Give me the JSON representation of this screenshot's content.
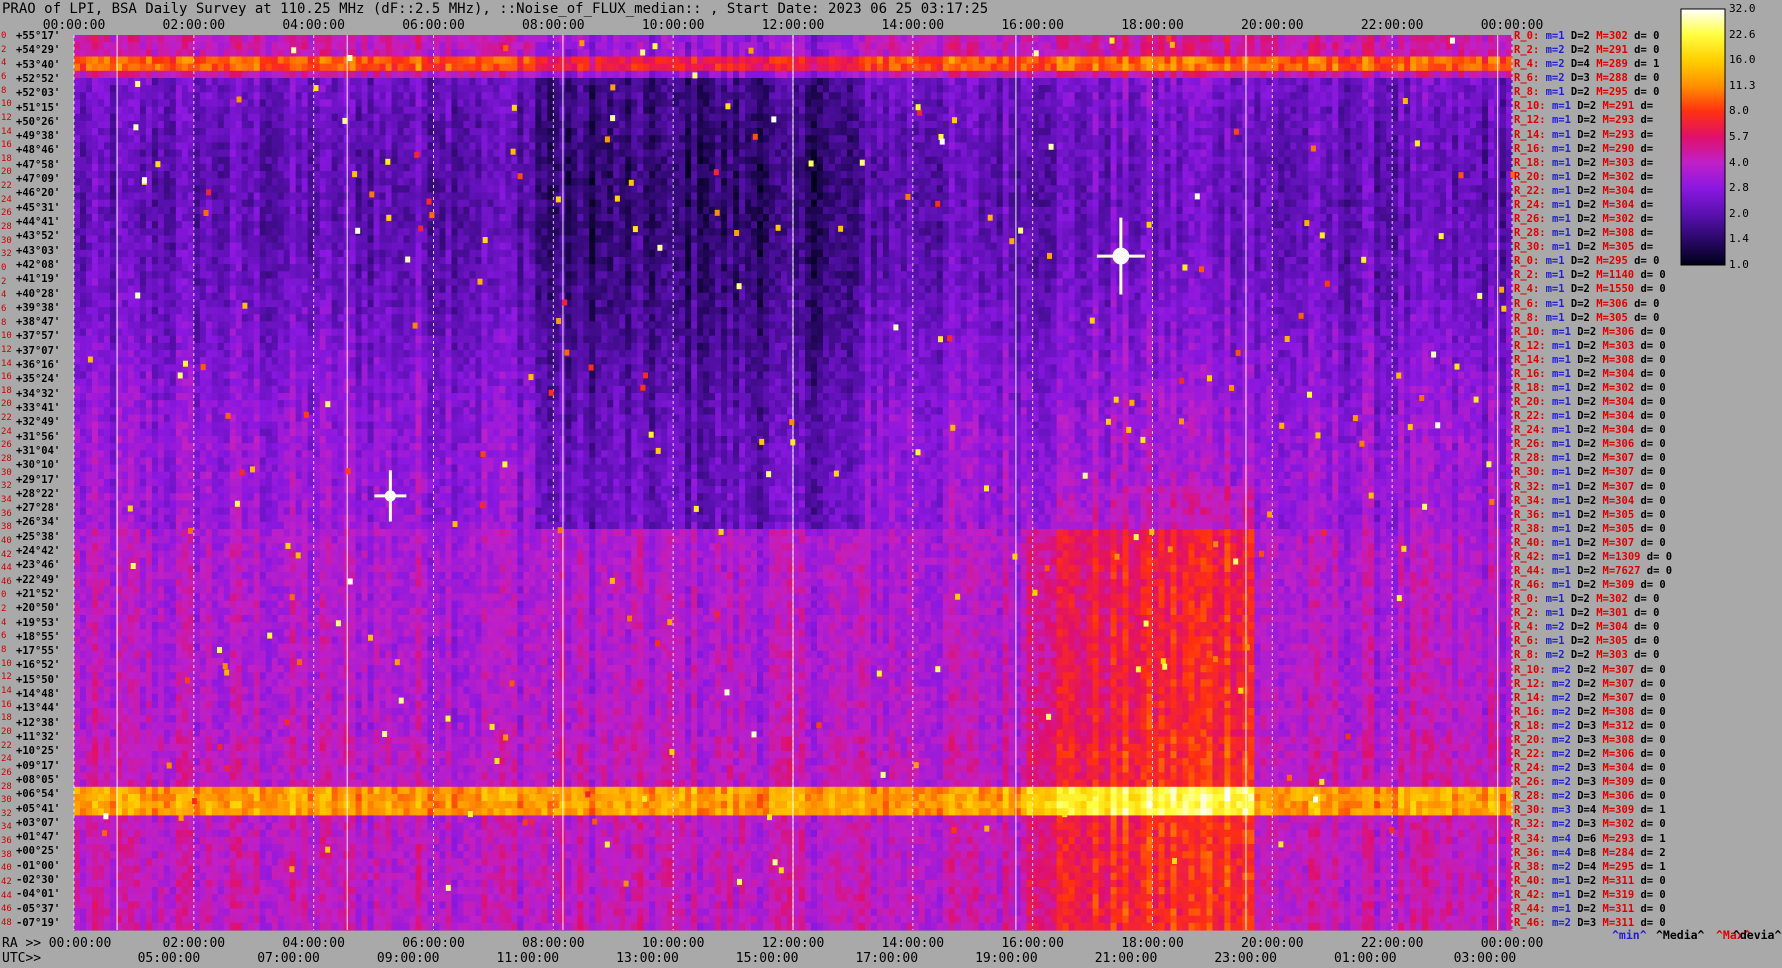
{
  "title": "PRAO of LPI, BSA Daily Survey at 110.25 MHz (dF::2.5 MHz), ::Noise_of_FLUX_median:: , Start Date: 2023 06 25 03:17:25",
  "chart_data": {
    "type": "heatmap",
    "title": "PRAO of LPI, BSA Daily Survey at 110.25 MHz (dF::2.5 MHz), ::Noise_of_FLUX_median:: , Start Date: 2023 06 25 03:17:25",
    "x_top_ticks": [
      "00:00:00",
      "02:00:00",
      "04:00:00",
      "06:00:00",
      "08:00:00",
      "10:00:00",
      "12:00:00",
      "14:00:00",
      "16:00:00",
      "18:00:00",
      "20:00:00",
      "22:00:00",
      "00:00:00"
    ],
    "x_ra_label": "RA >>",
    "x_ra_ticks": [
      "00:00:00",
      "02:00:00",
      "04:00:00",
      "06:00:00",
      "08:00:00",
      "10:00:00",
      "12:00:00",
      "14:00:00",
      "16:00:00",
      "18:00:00",
      "20:00:00",
      "22:00:00",
      "00:00:00"
    ],
    "x_utc_label": "UTC>>",
    "x_utc_ticks": [
      "05:00:00",
      "07:00:00",
      "09:00:00",
      "11:00:00",
      "13:00:00",
      "15:00:00",
      "17:00:00",
      "19:00:00",
      "21:00:00",
      "23:00:00",
      "01:00:00",
      "03:00:00"
    ],
    "y_ticks": [
      "+55°17'",
      "+54°29'",
      "+53°40'",
      "+52°52'",
      "+52°03'",
      "+51°15'",
      "+50°26'",
      "+49°38'",
      "+48°46'",
      "+47°58'",
      "+47°09'",
      "+46°20'",
      "+45°31'",
      "+44°41'",
      "+43°52'",
      "+43°03'",
      "+42°08'",
      "+41°19'",
      "+40°28'",
      "+39°38'",
      "+38°47'",
      "+37°57'",
      "+37°07'",
      "+36°16'",
      "+35°24'",
      "+34°32'",
      "+33°41'",
      "+32°49'",
      "+31°56'",
      "+31°04'",
      "+30°10'",
      "+29°17'",
      "+28°22'",
      "+27°28'",
      "+26°34'",
      "+25°38'",
      "+24°42'",
      "+23°46'",
      "+22°49'",
      "+21°52'",
      "+20°50'",
      "+19°53'",
      "+18°55'",
      "+17°55'",
      "+16°52'",
      "+15°50'",
      "+14°48'",
      "+13°44'",
      "+12°38'",
      "+11°32'",
      "+10°25'",
      "+09°17'",
      "+08°05'",
      "+06°54'",
      "+05°41'",
      "+03°07'",
      "+01°47'",
      "+00°25'",
      "-01°00'",
      "-02°30'",
      "-04°01'",
      "-05°37'",
      "-07°19'"
    ],
    "row_numbers": [
      "0",
      "2",
      "4",
      "6",
      "8",
      "10",
      "12",
      "14",
      "16",
      "18",
      "20",
      "22",
      "24",
      "26",
      "28",
      "30",
      "32",
      "0",
      "2",
      "4",
      "6",
      "8",
      "10",
      "12",
      "14",
      "16",
      "18",
      "20",
      "22",
      "24",
      "26",
      "28",
      "30",
      "32",
      "34",
      "36",
      "38",
      "40",
      "42",
      "44",
      "46",
      "0",
      "2",
      "4",
      "6",
      "8",
      "10",
      "12",
      "14",
      "16",
      "18",
      "20",
      "22",
      "24",
      "26",
      "28",
      "30",
      "32",
      "34",
      "36",
      "38",
      "40",
      "42",
      "44",
      "46",
      "48"
    ],
    "colorbar": {
      "ticks": [
        "32.0",
        "22.6",
        "16.0",
        "11.3",
        "8.0",
        "5.7",
        "4.0",
        "2.8",
        "2.0",
        "1.4",
        "1.0"
      ],
      "colors": [
        "#ffffff",
        "#ffff40",
        "#ffd000",
        "#ff9000",
        "#ff3010",
        "#e0106a",
        "#c020c8",
        "#8a18e0",
        "#5a10b0",
        "#2a0868",
        "#000018"
      ]
    },
    "stats_header": [
      "^min^",
      "^Media^",
      "^Max^",
      "^devia^"
    ],
    "stats_rows": [
      {
        "r": "R_0:",
        "m": "m=1",
        "d": "D=2",
        "mx": "M=302",
        "dv": "d= 0"
      },
      {
        "r": "R_2:",
        "m": "m=2",
        "d": "D=2",
        "mx": "M=291",
        "dv": "d= 0"
      },
      {
        "r": "R_4:",
        "m": "m=2",
        "d": "D=4",
        "mx": "M=289",
        "dv": "d= 1"
      },
      {
        "r": "R_6:",
        "m": "m=2",
        "d": "D=3",
        "mx": "M=288",
        "dv": "d= 0"
      },
      {
        "r": "R_8:",
        "m": "m=1",
        "d": "D=2",
        "mx": "M=295",
        "dv": "d= 0"
      },
      {
        "r": "R_10:",
        "m": "m=1",
        "d": "D=2",
        "mx": "M=291",
        "dv": "d="
      },
      {
        "r": "R_12:",
        "m": "m=1",
        "d": "D=2",
        "mx": "M=293",
        "dv": "d="
      },
      {
        "r": "R_14:",
        "m": "m=1",
        "d": "D=2",
        "mx": "M=293",
        "dv": "d="
      },
      {
        "r": "R_16:",
        "m": "m=1",
        "d": "D=2",
        "mx": "M=290",
        "dv": "d="
      },
      {
        "r": "R_18:",
        "m": "m=1",
        "d": "D=2",
        "mx": "M=303",
        "dv": "d="
      },
      {
        "r": "R_20:",
        "m": "m=1",
        "d": "D=2",
        "mx": "M=302",
        "dv": "d="
      },
      {
        "r": "R_22:",
        "m": "m=1",
        "d": "D=2",
        "mx": "M=304",
        "dv": "d="
      },
      {
        "r": "R_24:",
        "m": "m=1",
        "d": "D=2",
        "mx": "M=304",
        "dv": "d="
      },
      {
        "r": "R_26:",
        "m": "m=1",
        "d": "D=2",
        "mx": "M=302",
        "dv": "d="
      },
      {
        "r": "R_28:",
        "m": "m=1",
        "d": "D=2",
        "mx": "M=308",
        "dv": "d="
      },
      {
        "r": "R_30:",
        "m": "m=1",
        "d": "D=2",
        "mx": "M=305",
        "dv": "d="
      },
      {
        "r": "R_0:",
        "m": "m=1",
        "d": "D=2",
        "mx": "M=295",
        "dv": "d= 0"
      },
      {
        "r": "R_2:",
        "m": "m=1",
        "d": "D=2",
        "mx": "M=1140",
        "dv": "d= 0"
      },
      {
        "r": "R_4:",
        "m": "m=1",
        "d": "D=2",
        "mx": "M=1550",
        "dv": "d= 0"
      },
      {
        "r": "R_6:",
        "m": "m=1",
        "d": "D=2",
        "mx": "M=306",
        "dv": "d= 0"
      },
      {
        "r": "R_8:",
        "m": "m=1",
        "d": "D=2",
        "mx": "M=305",
        "dv": "d= 0"
      },
      {
        "r": "R_10:",
        "m": "m=1",
        "d": "D=2",
        "mx": "M=306",
        "dv": "d= 0"
      },
      {
        "r": "R_12:",
        "m": "m=1",
        "d": "D=2",
        "mx": "M=303",
        "dv": "d= 0"
      },
      {
        "r": "R_14:",
        "m": "m=1",
        "d": "D=2",
        "mx": "M=308",
        "dv": "d= 0"
      },
      {
        "r": "R_16:",
        "m": "m=1",
        "d": "D=2",
        "mx": "M=304",
        "dv": "d= 0"
      },
      {
        "r": "R_18:",
        "m": "m=1",
        "d": "D=2",
        "mx": "M=302",
        "dv": "d= 0"
      },
      {
        "r": "R_20:",
        "m": "m=1",
        "d": "D=2",
        "mx": "M=304",
        "dv": "d= 0"
      },
      {
        "r": "R_22:",
        "m": "m=1",
        "d": "D=2",
        "mx": "M=304",
        "dv": "d= 0"
      },
      {
        "r": "R_24:",
        "m": "m=1",
        "d": "D=2",
        "mx": "M=304",
        "dv": "d= 0"
      },
      {
        "r": "R_26:",
        "m": "m=1",
        "d": "D=2",
        "mx": "M=306",
        "dv": "d= 0"
      },
      {
        "r": "R_28:",
        "m": "m=1",
        "d": "D=2",
        "mx": "M=307",
        "dv": "d= 0"
      },
      {
        "r": "R_30:",
        "m": "m=1",
        "d": "D=2",
        "mx": "M=307",
        "dv": "d= 0"
      },
      {
        "r": "R_32:",
        "m": "m=1",
        "d": "D=2",
        "mx": "M=307",
        "dv": "d= 0"
      },
      {
        "r": "R_34:",
        "m": "m=1",
        "d": "D=2",
        "mx": "M=304",
        "dv": "d= 0"
      },
      {
        "r": "R_36:",
        "m": "m=1",
        "d": "D=2",
        "mx": "M=305",
        "dv": "d= 0"
      },
      {
        "r": "R_38:",
        "m": "m=1",
        "d": "D=2",
        "mx": "M=305",
        "dv": "d= 0"
      },
      {
        "r": "R_40:",
        "m": "m=1",
        "d": "D=2",
        "mx": "M=307",
        "dv": "d= 0"
      },
      {
        "r": "R_42:",
        "m": "m=1",
        "d": "D=2",
        "mx": "M=1309",
        "dv": "d= 0"
      },
      {
        "r": "R_44:",
        "m": "m=1",
        "d": "D=2",
        "mx": "M=7627",
        "dv": "d= 0"
      },
      {
        "r": "R_46:",
        "m": "m=1",
        "d": "D=2",
        "mx": "M=309",
        "dv": "d= 0"
      },
      {
        "r": "R_0:",
        "m": "m=1",
        "d": "D=2",
        "mx": "M=302",
        "dv": "d= 0"
      },
      {
        "r": "R_2:",
        "m": "m=1",
        "d": "D=2",
        "mx": "M=301",
        "dv": "d= 0"
      },
      {
        "r": "R_4:",
        "m": "m=2",
        "d": "D=2",
        "mx": "M=304",
        "dv": "d= 0"
      },
      {
        "r": "R_6:",
        "m": "m=1",
        "d": "D=2",
        "mx": "M=305",
        "dv": "d= 0"
      },
      {
        "r": "R_8:",
        "m": "m=2",
        "d": "D=2",
        "mx": "M=303",
        "dv": "d= 0"
      },
      {
        "r": "R_10:",
        "m": "m=2",
        "d": "D=2",
        "mx": "M=307",
        "dv": "d= 0"
      },
      {
        "r": "R_12:",
        "m": "m=2",
        "d": "D=2",
        "mx": "M=307",
        "dv": "d= 0"
      },
      {
        "r": "R_14:",
        "m": "m=2",
        "d": "D=2",
        "mx": "M=307",
        "dv": "d= 0"
      },
      {
        "r": "R_16:",
        "m": "m=2",
        "d": "D=2",
        "mx": "M=308",
        "dv": "d= 0"
      },
      {
        "r": "R_18:",
        "m": "m=2",
        "d": "D=3",
        "mx": "M=312",
        "dv": "d= 0"
      },
      {
        "r": "R_20:",
        "m": "m=2",
        "d": "D=3",
        "mx": "M=308",
        "dv": "d= 0"
      },
      {
        "r": "R_22:",
        "m": "m=2",
        "d": "D=2",
        "mx": "M=306",
        "dv": "d= 0"
      },
      {
        "r": "R_24:",
        "m": "m=2",
        "d": "D=3",
        "mx": "M=304",
        "dv": "d= 0"
      },
      {
        "r": "R_26:",
        "m": "m=2",
        "d": "D=3",
        "mx": "M=309",
        "dv": "d= 0"
      },
      {
        "r": "R_28:",
        "m": "m=2",
        "d": "D=3",
        "mx": "M=306",
        "dv": "d= 0"
      },
      {
        "r": "R_30:",
        "m": "m=3",
        "d": "D=4",
        "mx": "M=309",
        "dv": "d= 1"
      },
      {
        "r": "R_32:",
        "m": "m=2",
        "d": "D=3",
        "mx": "M=302",
        "dv": "d= 0"
      },
      {
        "r": "R_34:",
        "m": "m=4",
        "d": "D=6",
        "mx": "M=293",
        "dv": "d= 1"
      },
      {
        "r": "R_36:",
        "m": "m=4",
        "d": "D=8",
        "mx": "M=284",
        "dv": "d= 2"
      },
      {
        "r": "R_38:",
        "m": "m=2",
        "d": "D=4",
        "mx": "M=295",
        "dv": "d= 1"
      },
      {
        "r": "R_40:",
        "m": "m=1",
        "d": "D=2",
        "mx": "M=311",
        "dv": "d= 0"
      },
      {
        "r": "R_42:",
        "m": "m=1",
        "d": "D=2",
        "mx": "M=319",
        "dv": "d= 0"
      },
      {
        "r": "R_44:",
        "m": "m=1",
        "d": "D=2",
        "mx": "M=311",
        "dv": "d= 0"
      },
      {
        "r": "R_46:",
        "m": "m=2",
        "d": "D=3",
        "mx": "M=311",
        "dv": "d= 0"
      }
    ]
  }
}
